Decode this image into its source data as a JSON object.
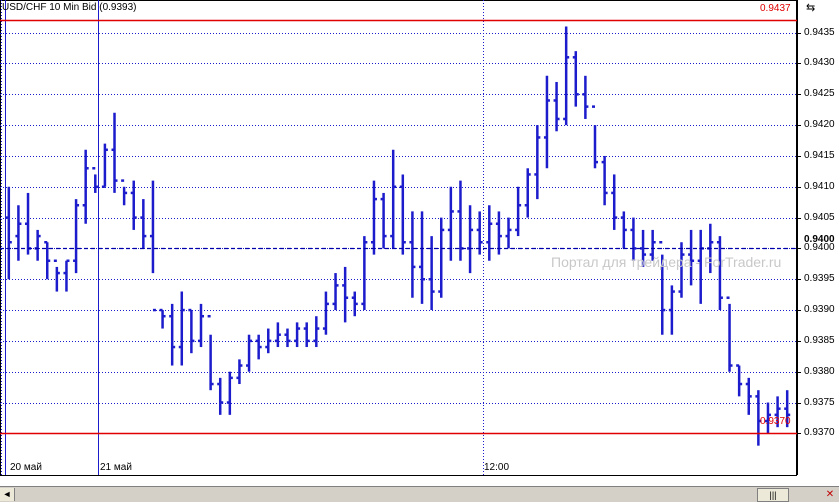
{
  "window": {
    "title": "USD/CHF 10 Min Bid (0.9393)",
    "watermark": "Портал для трейдера - ForTrader.ru",
    "zoom_icon": "zoom-to-fit-icon"
  },
  "price_tags": {
    "top_level": "0.9437",
    "bottom_level": "0.9370",
    "current": "0.9400"
  },
  "y_axis_ticks": [
    "0.9435",
    "0.9430",
    "0.9425",
    "0.9420",
    "0.9415",
    "0.9410",
    "0.9405",
    "0.9400",
    "0.9395",
    "0.9390",
    "0.9385",
    "0.9380",
    "0.9375",
    "0.9370"
  ],
  "x_axis_ticks": [
    "20 май",
    "21 май",
    "12:00"
  ],
  "scrollbar": {
    "left_glyph": "◄",
    "thumb_glyph": "|||",
    "close_glyph": "✕"
  },
  "colors": {
    "bars": "#1c1ccc",
    "grid": "#1c1ccc",
    "level_lines": "#e00000",
    "current_line": "#0000aa"
  },
  "chart_data": {
    "type": "ohlc",
    "instrument": "USD/CHF",
    "timeframe": "10 Min",
    "ylim": [
      0.9366,
      0.9439
    ],
    "grid": true,
    "horizontal_levels": [
      0.9437,
      0.937
    ],
    "current_price_line": 0.94,
    "bars": [
      [
        0.9405,
        0.941,
        0.9395,
        0.9401
      ],
      [
        0.9402,
        0.9407,
        0.9398,
        0.9404
      ],
      [
        0.9404,
        0.9409,
        0.9399,
        0.94
      ],
      [
        0.94,
        0.9403,
        0.9398,
        0.9402
      ],
      [
        0.9401,
        0.9401,
        0.9395,
        0.9398
      ],
      [
        0.9398,
        0.9397,
        0.9393,
        0.9396
      ],
      [
        0.9396,
        0.9398,
        0.9393,
        0.9398
      ],
      [
        0.9398,
        0.9408,
        0.9396,
        0.9407
      ],
      [
        0.9407,
        0.9416,
        0.9404,
        0.9413
      ],
      [
        0.9413,
        0.9412,
        0.9409,
        0.941
      ],
      [
        0.941,
        0.9417,
        0.941,
        0.9416
      ],
      [
        0.9416,
        0.9422,
        0.9409,
        0.9411
      ],
      [
        0.9411,
        0.941,
        0.9407,
        0.9409
      ],
      [
        0.9409,
        0.9411,
        0.9403,
        0.9405
      ],
      [
        0.9405,
        0.9408,
        0.94,
        0.9402
      ],
      [
        0.9402,
        0.9411,
        0.9396,
        0.939
      ],
      [
        0.939,
        0.939,
        0.9387,
        0.9389
      ],
      [
        0.9389,
        0.9391,
        0.9381,
        0.9384
      ],
      [
        0.9384,
        0.9393,
        0.9381,
        0.939
      ],
      [
        0.939,
        0.939,
        0.9383,
        0.9385
      ],
      [
        0.9385,
        0.9391,
        0.9384,
        0.9389
      ],
      [
        0.9389,
        0.9386,
        0.9377,
        0.9378
      ],
      [
        0.9378,
        0.9379,
        0.9373,
        0.9375
      ],
      [
        0.9375,
        0.938,
        0.9373,
        0.9379
      ],
      [
        0.9379,
        0.9382,
        0.9378,
        0.9381
      ],
      [
        0.9381,
        0.9386,
        0.938,
        0.9385
      ],
      [
        0.9385,
        0.9386,
        0.9382,
        0.9384
      ],
      [
        0.9384,
        0.9387,
        0.9383,
        0.9385
      ],
      [
        0.9385,
        0.9388,
        0.9384,
        0.9386
      ],
      [
        0.9386,
        0.9387,
        0.9384,
        0.9385
      ],
      [
        0.9385,
        0.9388,
        0.9384,
        0.9387
      ],
      [
        0.9387,
        0.9388,
        0.9384,
        0.9385
      ],
      [
        0.9385,
        0.9389,
        0.9384,
        0.9387
      ],
      [
        0.9387,
        0.9393,
        0.9386,
        0.9391
      ],
      [
        0.9391,
        0.9396,
        0.939,
        0.9394
      ],
      [
        0.9394,
        0.9397,
        0.9388,
        0.9392
      ],
      [
        0.9392,
        0.9393,
        0.9389,
        0.9391
      ],
      [
        0.9391,
        0.9402,
        0.939,
        0.9401
      ],
      [
        0.9401,
        0.9411,
        0.9399,
        0.9408
      ],
      [
        0.9408,
        0.9409,
        0.94,
        0.9402
      ],
      [
        0.9402,
        0.9416,
        0.94,
        0.941
      ],
      [
        0.941,
        0.9412,
        0.9399,
        0.9401
      ],
      [
        0.9401,
        0.9406,
        0.9392,
        0.9397
      ],
      [
        0.9397,
        0.9406,
        0.9391,
        0.9395
      ],
      [
        0.9395,
        0.9402,
        0.939,
        0.9393
      ],
      [
        0.9393,
        0.9405,
        0.9392,
        0.9403
      ],
      [
        0.9403,
        0.941,
        0.9398,
        0.9406
      ],
      [
        0.9406,
        0.9411,
        0.9398,
        0.94
      ],
      [
        0.94,
        0.9407,
        0.9396,
        0.9403
      ],
      [
        0.9403,
        0.9406,
        0.9399,
        0.9401
      ],
      [
        0.9401,
        0.9407,
        0.9398,
        0.9404
      ],
      [
        0.9404,
        0.9406,
        0.9399,
        0.9402
      ],
      [
        0.9402,
        0.9405,
        0.94,
        0.9403
      ],
      [
        0.9403,
        0.941,
        0.9402,
        0.9407
      ],
      [
        0.9407,
        0.9413,
        0.9405,
        0.9412
      ],
      [
        0.9412,
        0.942,
        0.9408,
        0.9418
      ],
      [
        0.9418,
        0.9428,
        0.9413,
        0.9424
      ],
      [
        0.9424,
        0.9427,
        0.9419,
        0.9421
      ],
      [
        0.9421,
        0.9436,
        0.942,
        0.9431
      ],
      [
        0.9431,
        0.9432,
        0.9423,
        0.9425
      ],
      [
        0.9425,
        0.9428,
        0.9421,
        0.9423
      ],
      [
        0.9423,
        0.942,
        0.9413,
        0.9414
      ],
      [
        0.9414,
        0.9415,
        0.9407,
        0.9409
      ],
      [
        0.9409,
        0.9412,
        0.9403,
        0.9405
      ],
      [
        0.9405,
        0.9406,
        0.94,
        0.9403
      ],
      [
        0.9403,
        0.9405,
        0.9398,
        0.94
      ],
      [
        0.94,
        0.9403,
        0.9397,
        0.9399
      ],
      [
        0.9399,
        0.9403,
        0.9398,
        0.9401
      ],
      [
        0.9401,
        0.9399,
        0.9386,
        0.939
      ],
      [
        0.939,
        0.9394,
        0.9386,
        0.9393
      ],
      [
        0.9393,
        0.9401,
        0.9392,
        0.9399
      ],
      [
        0.9399,
        0.9403,
        0.9394,
        0.9398
      ],
      [
        0.9398,
        0.9403,
        0.9391,
        0.94
      ],
      [
        0.94,
        0.9404,
        0.9396,
        0.9401
      ],
      [
        0.9401,
        0.9402,
        0.939,
        0.9392
      ],
      [
        0.9392,
        0.9391,
        0.938,
        0.9381
      ],
      [
        0.9381,
        0.9381,
        0.9376,
        0.9378
      ],
      [
        0.9378,
        0.9379,
        0.9373,
        0.9376
      ],
      [
        0.9376,
        0.9377,
        0.9368,
        0.9372
      ],
      [
        0.9372,
        0.9375,
        0.937,
        0.9373
      ],
      [
        0.9373,
        0.9376,
        0.9371,
        0.9374
      ],
      [
        0.9374,
        0.9377,
        0.9371,
        0.9373
      ]
    ]
  }
}
